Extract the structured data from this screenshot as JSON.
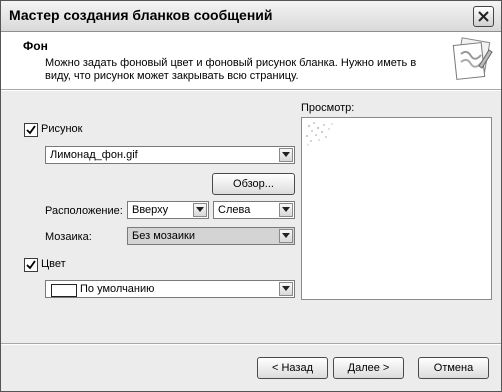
{
  "window": {
    "title": "Мастер создания бланков сообщений"
  },
  "header": {
    "title": "Фон",
    "description": "Можно задать фоновый цвет и фоновый рисунок бланка. Нужно иметь в виду, что рисунок может закрывать всю страницу."
  },
  "picture": {
    "checkbox_label": "Рисунок",
    "checked": true,
    "file": "Лимонад_фон.gif",
    "browse_label": "Обзор..."
  },
  "position": {
    "label": "Расположение:",
    "vertical": "Вверху",
    "horizontal": "Слева"
  },
  "tiling": {
    "label": "Мозаика:",
    "value": "Без мозаики"
  },
  "color": {
    "checkbox_label": "Цвет",
    "checked": true,
    "value": "По умолчанию"
  },
  "preview": {
    "label": "Просмотр:"
  },
  "buttons": {
    "back": "< Назад",
    "next": "Далее >",
    "cancel": "Отмена"
  }
}
